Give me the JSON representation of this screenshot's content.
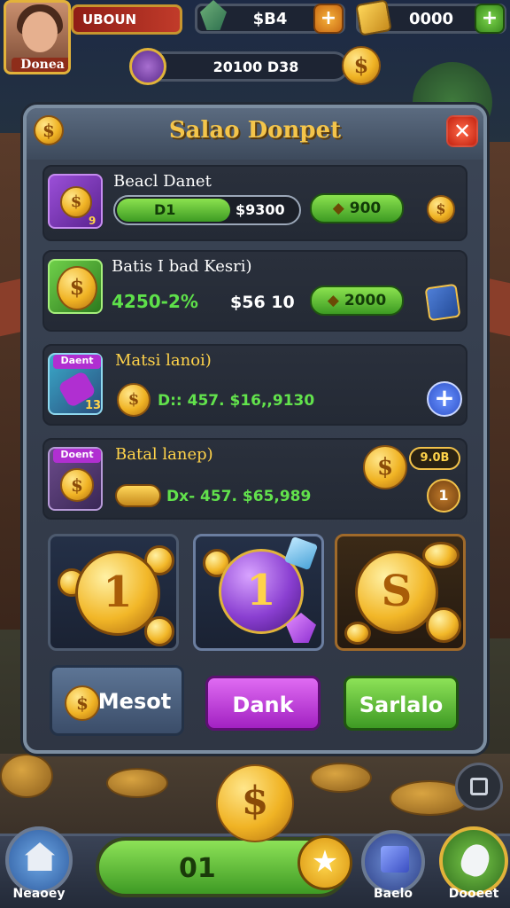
{
  "player": {
    "name": "Donea",
    "name_bar": "UBOUN"
  },
  "resources": {
    "gems": "$B4",
    "gold": "0000",
    "coins_total": "20100 D38"
  },
  "panel": {
    "title": "Salao Donpet"
  },
  "rows": [
    {
      "label": "Beacl Danet",
      "bar_left": "D1",
      "bar_right": "$9300",
      "reward": "900",
      "tile_badge": "9"
    },
    {
      "label": "Batis I bad Kesri)",
      "bonus": "4250-2%",
      "price": "$56 10",
      "reward": "2000"
    },
    {
      "label": "Matsi lanoi)",
      "tag": "Daent",
      "tile_badge": "13",
      "details": "D:: 457. $16,,9130"
    },
    {
      "label": "Batal lanep)",
      "tag": "Doent",
      "details": "Dx- 457. $65,989",
      "side_value": "9.0B"
    }
  ],
  "packs": [
    {
      "coin_label": "1"
    },
    {
      "coin_label": "1"
    },
    {
      "coin_label": "S"
    }
  ],
  "buttons": {
    "left": "Mesot",
    "middle": "Dank",
    "right": "Sarlalo"
  },
  "bottom_nav": {
    "left_label": "Neaoey",
    "center_value": "01",
    "right1_label": "Baelo",
    "right2_label": "Dooeet"
  },
  "colors": {
    "gold": "#f2b728",
    "green": "#5cc234",
    "purple": "#c13bd2",
    "blue_slate": "#4a5f80",
    "red": "#c2210f"
  }
}
